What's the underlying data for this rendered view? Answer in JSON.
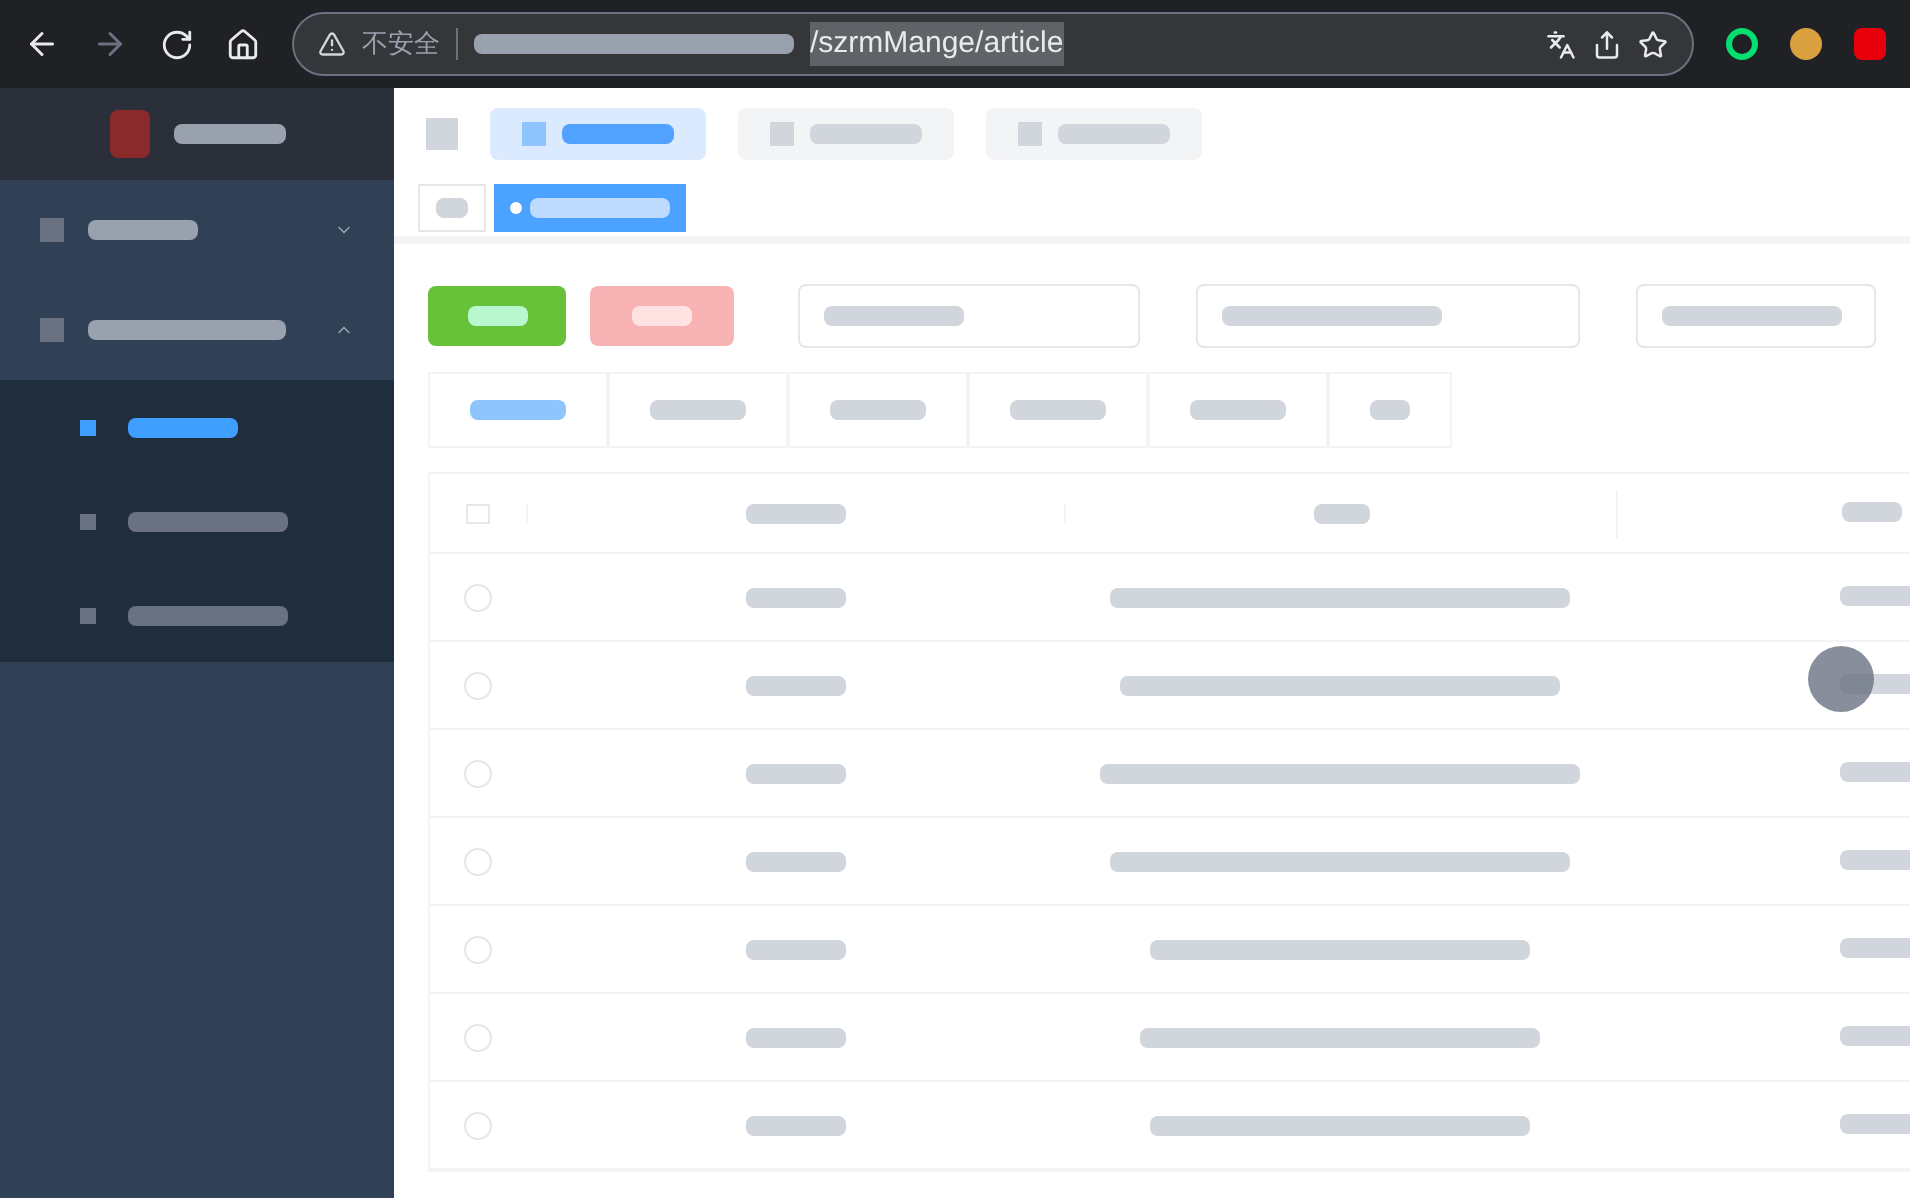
{
  "browser": {
    "security_label": "不安全",
    "url_path": "/szrmMange/article"
  },
  "sidebar": {
    "items": [
      {
        "expanded": false
      },
      {
        "expanded": true,
        "children": [
          {
            "selected": true
          },
          {
            "selected": false
          },
          {
            "selected": false
          }
        ]
      }
    ]
  },
  "top_tabs": [
    {
      "selected": true
    },
    {
      "selected": false
    },
    {
      "selected": false
    }
  ],
  "page_tags": [
    {
      "selected": false
    },
    {
      "selected": true
    }
  ],
  "filter_tabs": [
    {
      "selected": true
    },
    {
      "selected": false
    },
    {
      "selected": false
    },
    {
      "selected": false
    },
    {
      "selected": false
    },
    {
      "selected": false
    }
  ],
  "table": {
    "all_checked": false,
    "rows": [
      {
        "checked": false
      },
      {
        "checked": false
      },
      {
        "checked": false
      },
      {
        "checked": false
      },
      {
        "checked": false
      },
      {
        "checked": false
      },
      {
        "checked": false
      }
    ]
  }
}
